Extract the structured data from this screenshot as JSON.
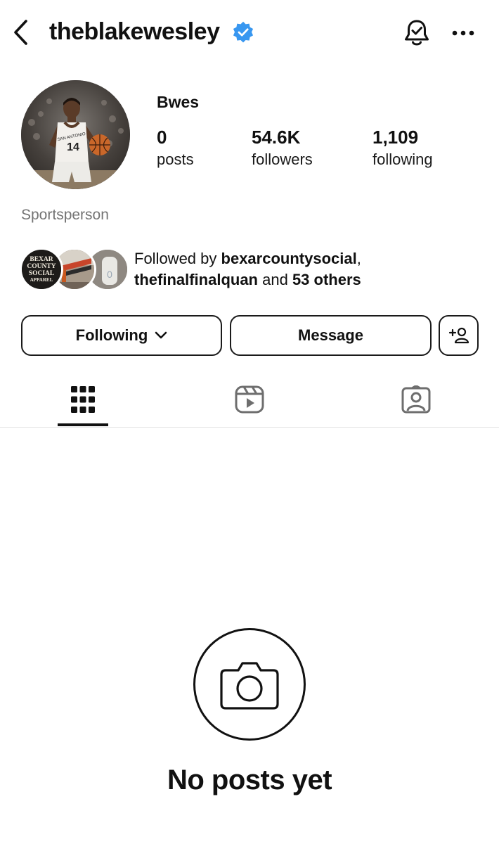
{
  "header": {
    "username": "theblakewesley",
    "verified": true,
    "icons": [
      "chevron-left-icon",
      "verified-badge-icon",
      "notification-bell-icon",
      "more-horizontal-icon"
    ]
  },
  "profile": {
    "display_name": "Bwes",
    "stats": [
      {
        "value": "0",
        "label": "posts"
      },
      {
        "value": "54.6K",
        "label": "followers"
      },
      {
        "value": "1,109",
        "label": "following"
      }
    ],
    "category": "Sportsperson",
    "avatar_jersey": "14",
    "avatar_jersey_text": "SAN ANTONIO"
  },
  "followed_by": {
    "prefix": "Followed by ",
    "user1": "bexarcountysocial",
    "sep": ",",
    "user2": "thefinalfinalquan",
    "mid": " and ",
    "others": "53 others",
    "mutual_logo_text": [
      "BEXAR",
      "COUNTY",
      "SOCIAL",
      "APPAREL"
    ]
  },
  "actions": {
    "following_label": "Following",
    "message_label": "Message"
  },
  "tabs": [
    "grid-icon",
    "reels-icon",
    "tagged-icon"
  ],
  "empty_state": {
    "title": "No posts yet",
    "icon": "camera-icon"
  },
  "colors": {
    "verified_blue": "#3897f0",
    "secondary_text": "#737373",
    "primary_text": "#111111"
  }
}
